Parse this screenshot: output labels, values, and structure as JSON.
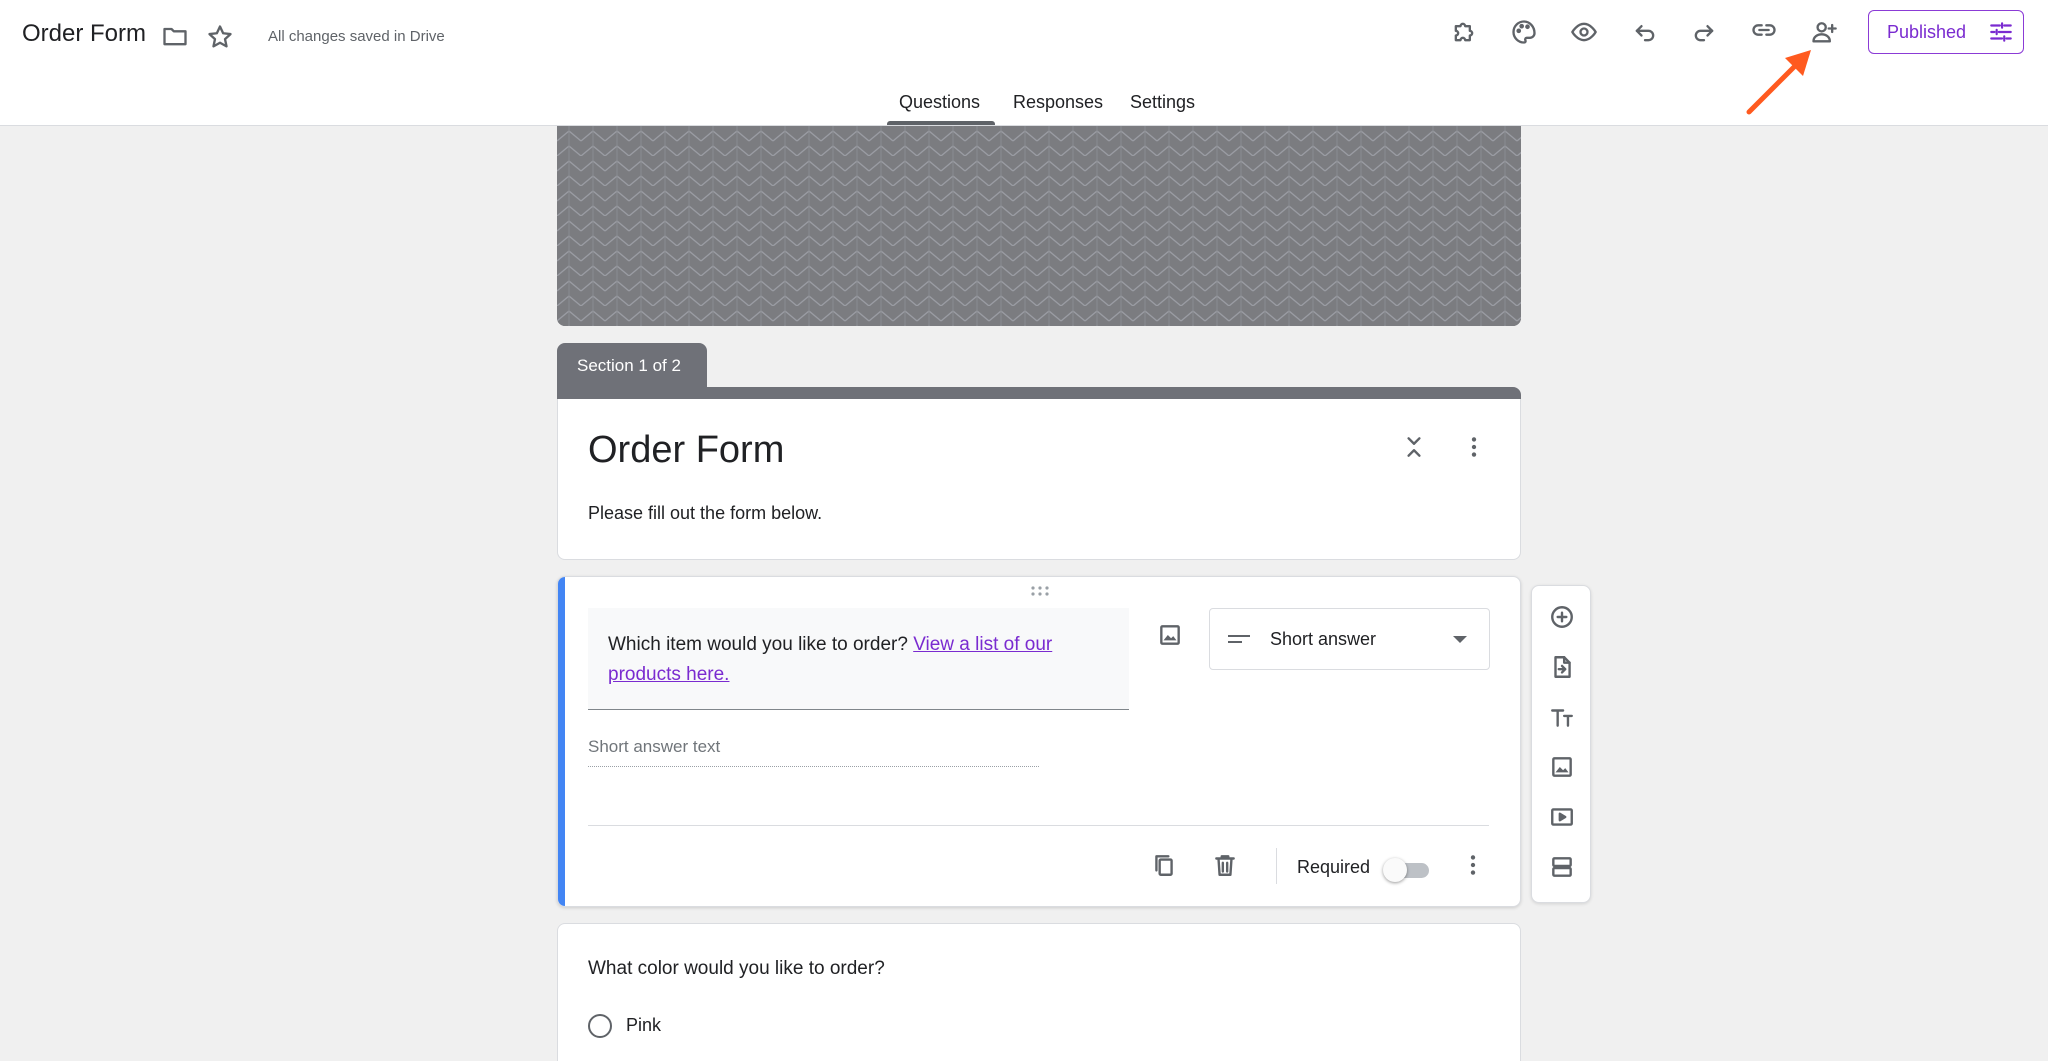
{
  "header": {
    "doc_title": "Order Form",
    "save_status": "All changes saved in Drive",
    "publish_label": "Published"
  },
  "tabs": [
    {
      "label": "Questions",
      "active": true
    },
    {
      "label": "Responses",
      "active": false
    },
    {
      "label": "Settings",
      "active": false
    }
  ],
  "section": {
    "label": "Section 1 of 2"
  },
  "form": {
    "title": "Order Form",
    "description": "Please fill out the form below."
  },
  "question1": {
    "text": "Which item would you like to order? ",
    "link_text": "View a list of our products here.",
    "type": "Short answer",
    "answer_placeholder": "Short answer text",
    "required_label": "Required",
    "required": false
  },
  "question2": {
    "text": "What color would you like to order?",
    "options": [
      "Pink"
    ]
  },
  "colors": {
    "accent": "#4285f4",
    "publish": "#7a2bd0",
    "annotation_arrow": "#ff5a1f",
    "section": "#6f7178"
  },
  "icons": {
    "header": [
      "folder-icon",
      "star-icon",
      "add-ons-icon",
      "palette-icon",
      "preview-icon",
      "undo-icon",
      "redo-icon",
      "link-icon",
      "add-collaborator-icon",
      "publish-settings-icon"
    ],
    "side_toolbar": [
      "add-question-icon",
      "import-questions-icon",
      "add-title-icon",
      "add-image-icon",
      "add-video-icon",
      "add-section-icon"
    ]
  }
}
